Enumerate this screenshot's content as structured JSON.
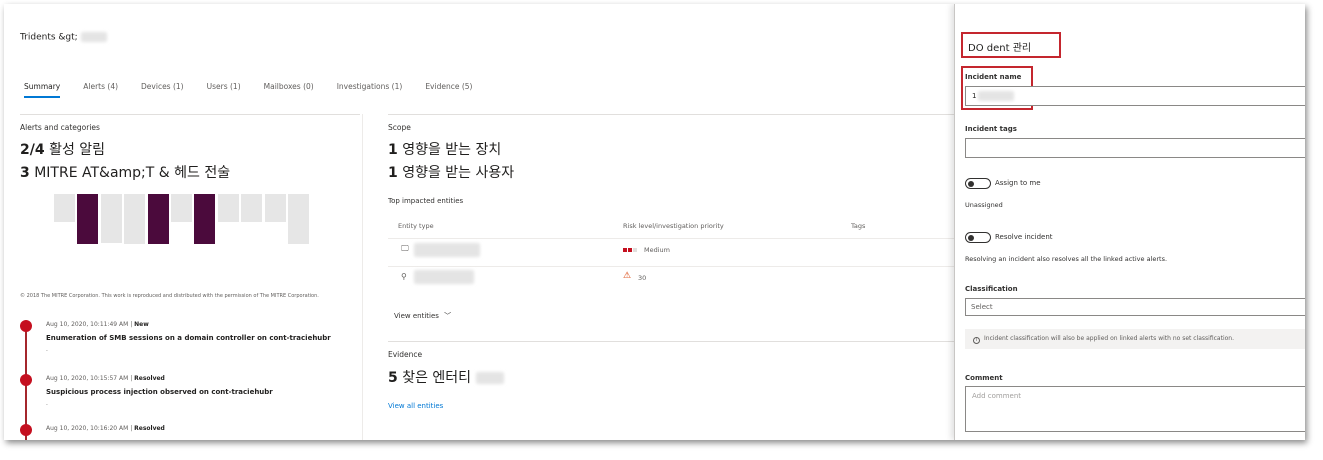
{
  "breadcrumb": "Tridents &gt;",
  "tabs": [
    {
      "label": "Summary",
      "active": true
    },
    {
      "label": "Alerts (4)"
    },
    {
      "label": "Devices (1)"
    },
    {
      "label": "Users (1)"
    },
    {
      "label": "Mailboxes (0)"
    },
    {
      "label": "Investigations (1)"
    },
    {
      "label": "Evidence (5)"
    }
  ],
  "alerts": {
    "label": "Alerts and categories",
    "active_count": "2/4",
    "active_text": "활성 알림",
    "mitre_count": "3",
    "mitre_text": "MITRE AT&amp;T & 헤드 전술",
    "copyright": "© 2018 The MITRE Corporation. This work is reproduced and distributed with the permission of The MITRE Corporation."
  },
  "mitre_columns": [
    {
      "up": 0.55,
      "down": 0.0,
      "active": false
    },
    {
      "up": 1.0,
      "down": 0.0,
      "active": true
    },
    {
      "up": 0.55,
      "down": 0.6,
      "active": false
    },
    {
      "up": 1.0,
      "down": 0.0,
      "active": false
    },
    {
      "up": 1.0,
      "down": 0.0,
      "active": true
    },
    {
      "up": 0.55,
      "down": 0.0,
      "active": false
    },
    {
      "up": 1.0,
      "down": 0.0,
      "active": true
    },
    {
      "up": 0.55,
      "down": 0.0,
      "active": false
    },
    {
      "up": 0.55,
      "down": 0.0,
      "active": false
    },
    {
      "up": 0.55,
      "down": 0.0,
      "active": false
    },
    {
      "up": 1.0,
      "down": 0.0,
      "active": false
    }
  ],
  "timeline": [
    {
      "time": "Aug 10, 2020, 10:11:49 AM | ",
      "status": "New",
      "title": "Enumeration of SMB sessions on a domain controller on cont-traciehubr",
      "sub": "."
    },
    {
      "time": "Aug 10, 2020, 10:15:57 AM | ",
      "status": "Resolved",
      "title": "Suspicious process injection observed on cont-traciehubr",
      "sub": "."
    },
    {
      "time": "Aug 10, 2020, 10:16:20 AM | ",
      "status": "Resolved",
      "title": "",
      "sub": ""
    }
  ],
  "scope": {
    "label": "Scope",
    "devices_count": "1",
    "devices_text": "영향을 받는 장치",
    "users_count": "1",
    "users_text": "영향을 받는 사용자",
    "top_label": "Top impacted entities",
    "col_entity": "Entity type",
    "col_risk": "Risk level/investigation priority",
    "col_tags": "Tags",
    "risk_medium": "Medium",
    "priority": "30",
    "view_entities": "View entities"
  },
  "evidence": {
    "label": "Evidence",
    "count": "5",
    "text": "찾은 엔터티",
    "link": "View all entities"
  },
  "panel": {
    "title": "DO dent 관리",
    "incident_name_label": "Incident name",
    "incident_name_value": "1",
    "tags_label": "Incident tags",
    "assign_label": "Assign to me",
    "unassigned": "Unassigned",
    "resolve_label": "Resolve incident",
    "resolve_note": "Resolving an incident also resolves all the linked active alerts.",
    "classification_label": "Classification",
    "classification_select": "Select",
    "classification_info": "Incident classification will also be applied on linked alerts with no set classification.",
    "comment_label": "Comment",
    "comment_placeholder": "Add comment"
  },
  "colors": {
    "accent": "#0078d4",
    "mitre_active": "#4b0a3c",
    "mitre_inactive": "#e6e6e6",
    "alert_red": "#c50f1f"
  }
}
